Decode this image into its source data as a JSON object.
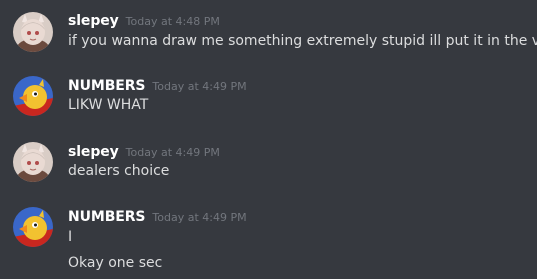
{
  "messages": [
    {
      "username": "slepey",
      "timestamp": "Today at 4:48 PM",
      "lines": [
        "if you wanna draw me something extremely stupid ill put it in the vid"
      ],
      "avatar_icon": "anime-girl-avatar-icon"
    },
    {
      "username": "NUMBERS",
      "timestamp": "Today at 4:49 PM",
      "lines": [
        "LIKW WHAT"
      ],
      "avatar_icon": "yellow-bird-avatar-icon"
    },
    {
      "username": "slepey",
      "timestamp": "Today at 4:49 PM",
      "lines": [
        "dealers choice"
      ],
      "avatar_icon": "anime-girl-avatar-icon"
    },
    {
      "username": "NUMBERS",
      "timestamp": "Today at 4:49 PM",
      "lines": [
        "I",
        "Okay one sec"
      ],
      "avatar_icon": "yellow-bird-avatar-icon"
    }
  ],
  "colors": {
    "background": "#36393f",
    "username": "#ffffff",
    "timestamp": "#72767d",
    "message_text": "#dcddde"
  }
}
